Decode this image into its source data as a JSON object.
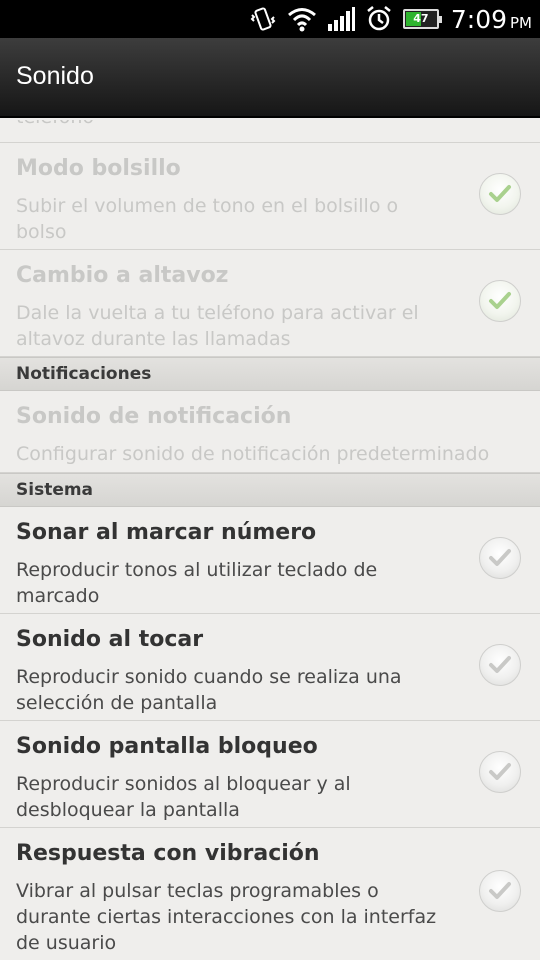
{
  "status_bar": {
    "battery_level": "47",
    "time": "7:09",
    "ampm": "PM"
  },
  "titlebar": {
    "title": "Sonido"
  },
  "list": {
    "partial_text": "teléfono",
    "items": [
      {
        "title": "Modo bolsillo",
        "summary": "Subir el volumen de tono en el bolsillo o bolso",
        "checked": true,
        "enabled": false
      },
      {
        "title": "Cambio a altavoz",
        "summary": "Dale la vuelta a tu teléfono para activar el altavoz durante las llamadas",
        "checked": true,
        "enabled": false
      }
    ],
    "section_notifications": "Notificaciones",
    "notification_item": {
      "title": "Sonido de notificación",
      "summary": "Configurar sonido de notificación predeterminado",
      "enabled": false
    },
    "section_system": "Sistema",
    "system_items": [
      {
        "title": "Sonar al marcar número",
        "summary": "Reproducir tonos al utilizar teclado de marcado",
        "checked": false,
        "enabled": true
      },
      {
        "title": "Sonido al tocar",
        "summary": "Reproducir sonido cuando se realiza una selección de pantalla",
        "checked": false,
        "enabled": true
      },
      {
        "title": "Sonido pantalla bloqueo",
        "summary": "Reproducir sonidos al bloquear y al desbloquear la pantalla",
        "checked": false,
        "enabled": true
      },
      {
        "title": "Respuesta con vibración",
        "summary": "Vibrar al pulsar teclas programables o durante ciertas interacciones con la interfaz de usuario",
        "checked": false,
        "enabled": true
      }
    ]
  },
  "colors": {
    "checkmark_on": "#a9d18e",
    "checkmark_off": "#c9c9c7",
    "background": "#efeeec"
  }
}
